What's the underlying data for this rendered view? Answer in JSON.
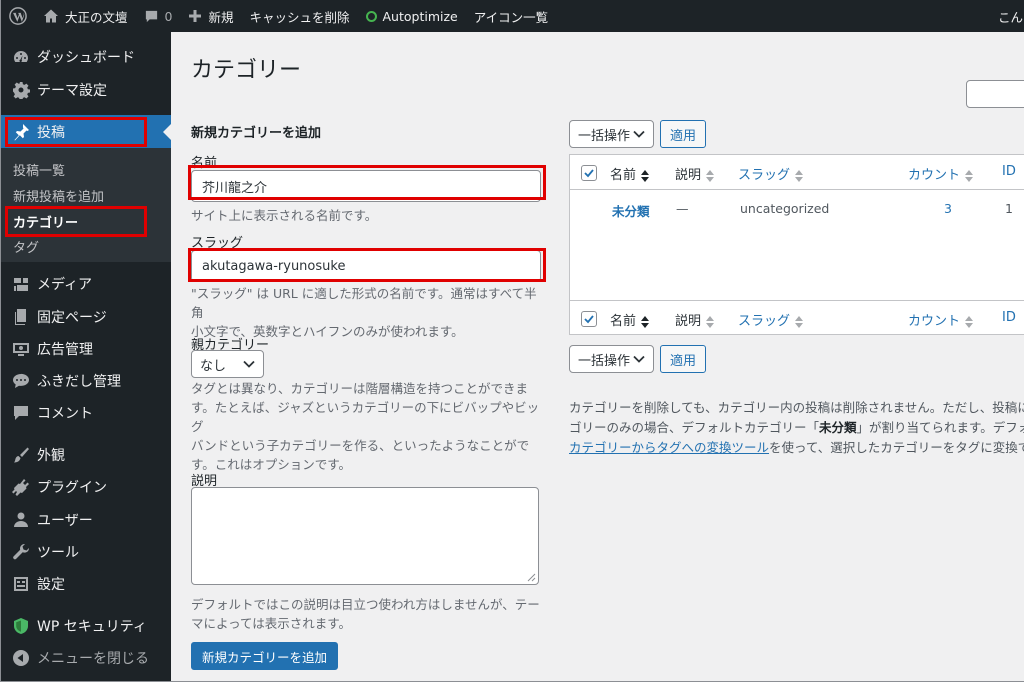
{
  "adminbar": {
    "site_name": "大正の文壇",
    "comments_count": "0",
    "new_label": "新規",
    "cache_label": "キャッシュを削除",
    "autoptimize_label": "Autoptimize",
    "icons_label": "アイコン一覧",
    "greeting": "こん"
  },
  "sidebar": {
    "dashboard": "ダッシュボード",
    "theme_settings": "テーマ設定",
    "posts": "投稿",
    "submenu": {
      "all_posts": "投稿一覧",
      "add_new": "新規投稿を追加",
      "categories": "カテゴリー",
      "tags": "タグ"
    },
    "media": "メディア",
    "pages": "固定ページ",
    "ads": "広告管理",
    "balloons": "ふきだし管理",
    "comments": "コメント",
    "appearance": "外観",
    "plugins": "プラグイン",
    "users": "ユーザー",
    "tools": "ツール",
    "settings": "設定",
    "wp_security": "WP セキュリティ",
    "collapse": "メニューを閉じる"
  },
  "page": {
    "title": "カテゴリー"
  },
  "form": {
    "heading": "新規カテゴリーを追加",
    "name_label": "名前",
    "name_value": "芥川龍之介",
    "name_help": "サイト上に表示される名前です。",
    "slug_label": "スラッグ",
    "slug_value": "akutagawa-ryunosuke",
    "slug_help_1": "\"スラッグ\" は URL に適した形式の名前です。通常はすべて半角",
    "slug_help_2": "小文字で、英数字とハイフンのみが使われます。",
    "parent_label": "親カテゴリー",
    "parent_value": "なし",
    "parent_help_1": "タグとは異なり、カテゴリーは階層構造を持つことができま",
    "parent_help_2": "す。たとえば、ジャズというカテゴリーの下にビバップやビッグ",
    "parent_help_3": "バンドという子カテゴリーを作る、といったようなことがで",
    "parent_help_4": "す。これはオプションです。",
    "desc_label": "説明",
    "desc_help_1": "デフォルトではこの説明は目立つ使われ方はしませんが、テー",
    "desc_help_2": "マによっては表示されます。",
    "submit_label": "新規カテゴリーを追加"
  },
  "list": {
    "bulk_label": "一括操作",
    "apply_label": "適用",
    "columns": {
      "name": "名前",
      "description": "説明",
      "slug": "スラッグ",
      "count": "カウント",
      "id": "ID"
    },
    "rows": [
      {
        "name": "未分類",
        "description": "—",
        "slug": "uncategorized",
        "count": "3",
        "id": "1"
      }
    ]
  },
  "notes": {
    "line1": "カテゴリーを削除しても、カテゴリー内の投稿は削除されません。ただし、投稿に割",
    "line2_a": "ゴリーのみの場合、デフォルトカテゴリー「",
    "line2_b": "未分類",
    "line2_c": "」が割り当てられます。デフォル",
    "link": "カテゴリーからタグへの変換ツール",
    "line3_rest": "を使って、選択したカテゴリーをタグに変換で"
  },
  "colors": {
    "accent": "#2271b1",
    "admin_dark": "#1d2327",
    "highlight_red": "#e00000"
  }
}
